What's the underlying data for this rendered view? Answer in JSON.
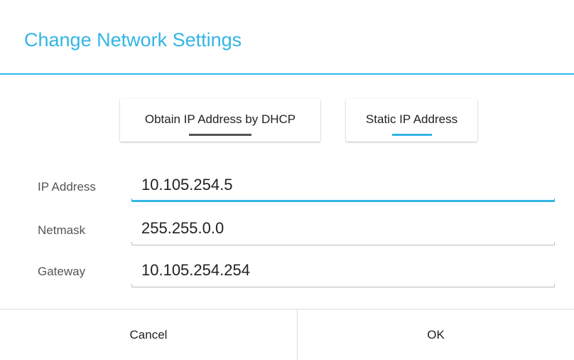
{
  "dialog": {
    "title": "Change Network Settings"
  },
  "mode": {
    "dhcp_label": "Obtain IP Address by DHCP",
    "static_label": "Static IP Address",
    "selected": "Static IP Address"
  },
  "fields": {
    "ip_address": {
      "label": "IP Address",
      "value": "10.105.254.5",
      "focused": true
    },
    "netmask": {
      "label": "Netmask",
      "value": "255.255.0.0"
    },
    "gateway": {
      "label": "Gateway",
      "value": "10.105.254.254"
    }
  },
  "footer": {
    "cancel_label": "Cancel",
    "ok_label": "OK"
  },
  "colors": {
    "accent": "#33b5e5",
    "text": "#222222",
    "label": "#555555"
  }
}
